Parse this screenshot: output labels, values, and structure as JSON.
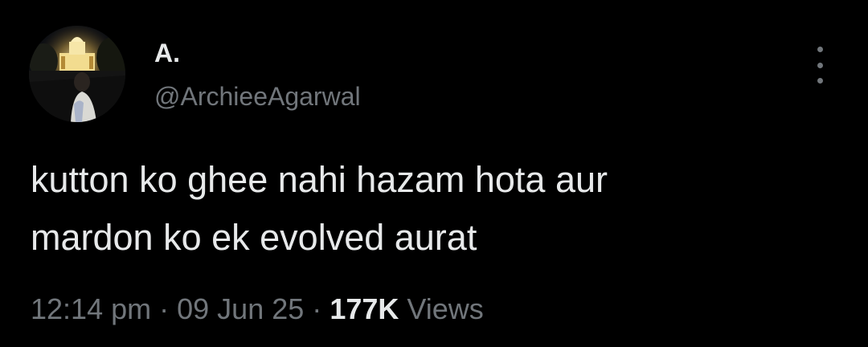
{
  "author": {
    "display_name": "A.",
    "handle": "@ArchieeAgarwal",
    "avatar_icon": "profile-photo-night-monument"
  },
  "menu": {
    "icon": "more-vertical-icon"
  },
  "tweet": {
    "lines": [
      "kutton ko ghee nahi hazam hota aur",
      "mardon ko ek evolved aurat"
    ]
  },
  "meta": {
    "time": "12:14 pm",
    "separator": "·",
    "date": "09 Jun 25",
    "views_count": "177K",
    "views_label": "Views"
  },
  "colors": {
    "background": "#000000",
    "primary_text": "#e7e9ea",
    "secondary_text": "#71767b"
  }
}
